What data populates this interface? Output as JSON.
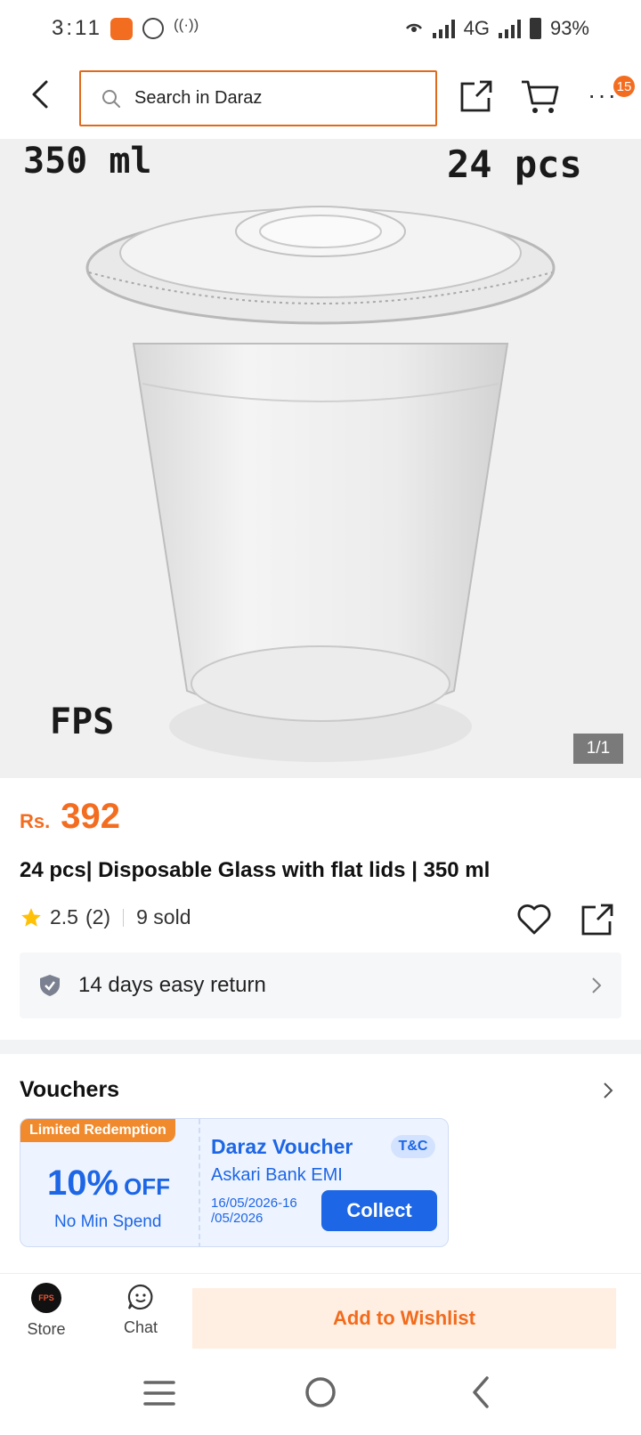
{
  "status_bar": {
    "time": "3:11",
    "network": "4G",
    "battery": "93%"
  },
  "header": {
    "search_placeholder": "Search in Daraz",
    "cart_badge": "15"
  },
  "product_image": {
    "top_left_text": "350 ml",
    "top_right_text": "24 pcs",
    "brand_text": "FPS",
    "counter": "1/1"
  },
  "product": {
    "currency": "Rs.",
    "price": "392",
    "title": "24 pcs| Disposable Glass with flat lids | 350 ml",
    "rating": "2.5",
    "review_count": "(2)",
    "sold": "9 sold",
    "return_policy": "14 days easy return"
  },
  "vouchers": {
    "heading": "Vouchers",
    "items": [
      {
        "tag": "Limited Redemption",
        "percent": "10%",
        "off_label": "OFF",
        "min_spend": "No Min Spend",
        "name": "Daraz Voucher",
        "tc_label": "T&C",
        "subtitle": "Askari Bank EMI",
        "date": "16/05/2026-16 /05/2026",
        "button": "Collect"
      }
    ]
  },
  "bottom_bar": {
    "store_label": "Store",
    "store_logo_text": "FPS",
    "chat_label": "Chat",
    "wishlist_label": "Add to Wishlist"
  },
  "colors": {
    "accent": "#f36d21",
    "voucher_blue": "#1d66e5",
    "wishlist_bg": "#ffefe3"
  }
}
